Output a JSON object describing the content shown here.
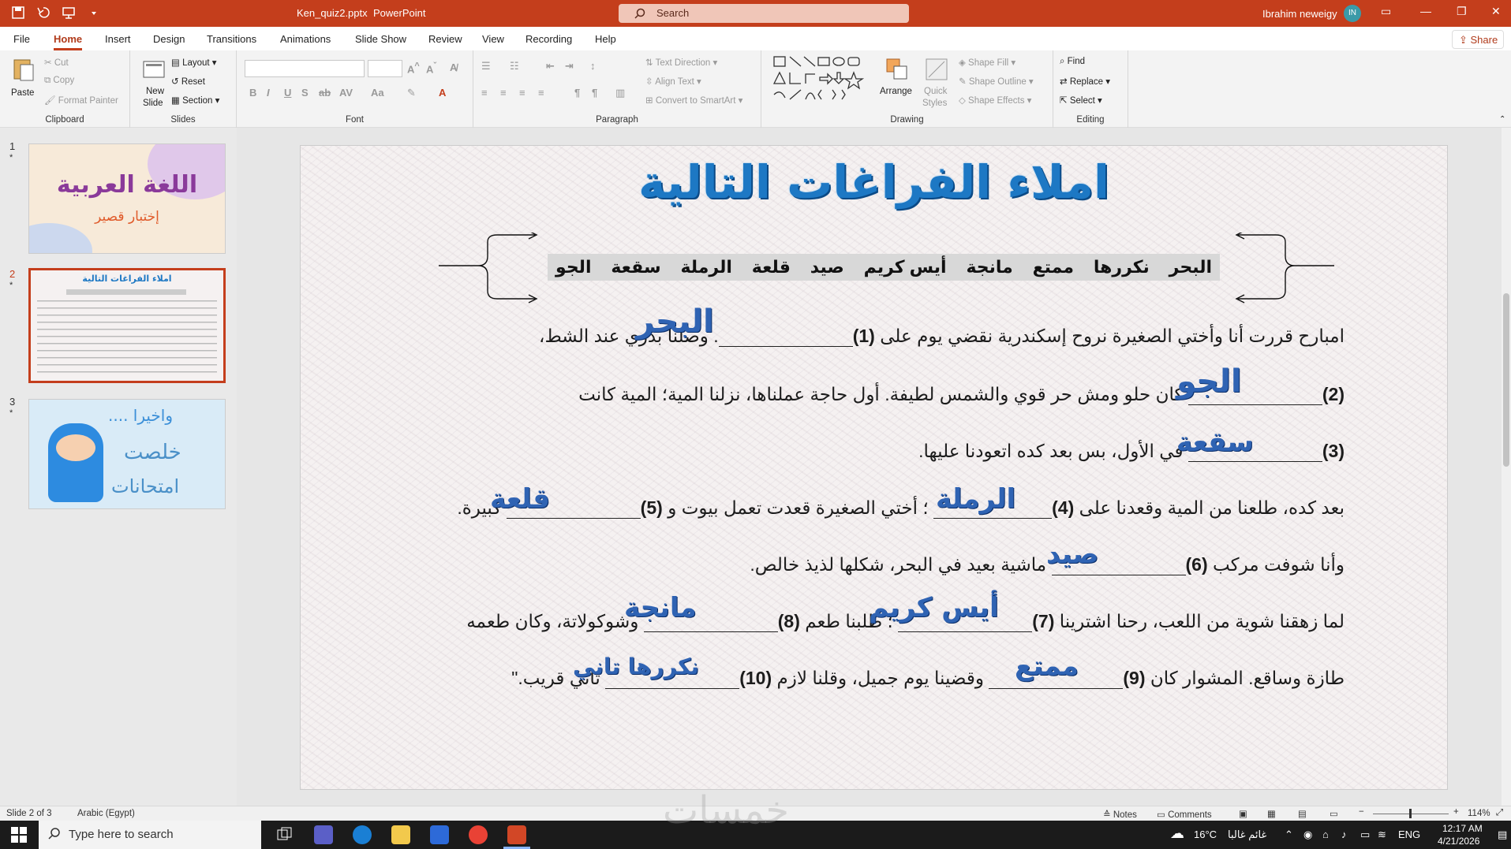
{
  "window": {
    "file_name": "Ken_quiz2.pptx",
    "app_name": "PowerPoint",
    "search_placeholder": "Search",
    "user_name": "Ibrahim neweigy",
    "user_initials": "IN"
  },
  "tabs": [
    "File",
    "Home",
    "Insert",
    "Design",
    "Transitions",
    "Animations",
    "Slide Show",
    "Review",
    "View",
    "Recording",
    "Help"
  ],
  "share_label": "Share",
  "ribbon": {
    "clipboard": {
      "label": "Clipboard",
      "paste": "Paste",
      "cut": "Cut",
      "copy": "Copy",
      "format_painter": "Format Painter"
    },
    "slides": {
      "label": "Slides",
      "new_slide_1": "New",
      "new_slide_2": "Slide",
      "layout": "Layout",
      "reset": "Reset",
      "section": "Section"
    },
    "font": {
      "label": "Font"
    },
    "paragraph": {
      "label": "Paragraph",
      "text_direction": "Text Direction",
      "align_text": "Align Text",
      "convert": "Convert to SmartArt"
    },
    "drawing": {
      "label": "Drawing",
      "arrange": "Arrange",
      "quick_styles_1": "Quick",
      "quick_styles_2": "Styles",
      "shape_fill": "Shape Fill",
      "shape_outline": "Shape Outline",
      "shape_effects": "Shape Effects"
    },
    "editing": {
      "label": "Editing",
      "find": "Find",
      "replace": "Replace",
      "select": "Select"
    }
  },
  "thumbnails": [
    {
      "num": "1",
      "title": "اللغة العربية",
      "subtitle": "إختبار قصير"
    },
    {
      "num": "2",
      "title": "املاء الفراغات التالية"
    },
    {
      "num": "3",
      "line1": "واخيرا ....",
      "line2": "خلصت",
      "line3": "امتحانات"
    }
  ],
  "slide": {
    "title": "املاء الفراغات التالية",
    "word_bank": [
      "البحر",
      "نكررها",
      "ممتع",
      "مانجة",
      "أيس كريم",
      "صيد",
      "قلعة",
      "الرملة",
      "سقعة",
      "الجو"
    ],
    "lines": [
      {
        "pre": "امبارح قررت أنا وأختي الصغيرة نروح إسكندرية نقضي يوم على",
        "num1": "(1)",
        "mid": ". وصلنا بدري عند الشط،"
      },
      {
        "num1": "(2)",
        "mid": "كان حلو ومش حر قوي والشمس لطيفة. أول حاجة عملناها، نزلنا المية؛ المية كانت"
      },
      {
        "num1": "(3)",
        "mid": "في الأول، بس بعد كده اتعودنا عليها."
      },
      {
        "pre": "بعد كده، طلعنا من المية وقعدنا على",
        "num1": "(4)",
        "mid": "؛ أختي الصغيرة قعدت تعمل بيوت و",
        "num2": "(5)",
        "post": "كبيرة."
      },
      {
        "pre": "وأنا شوفت مركب",
        "num1": "(6)",
        "mid": "ماشية بعيد في البحر، شكلها لذيذ خالص."
      },
      {
        "pre": "لما زهقنا شوية من اللعب، رحنا اشترينا",
        "num1": "(7)",
        "mid": "؛ طلبنا طعم",
        "num2": "(8)",
        "post": "وشوكولاتة، وكان طعمه"
      },
      {
        "pre": "طازة وساقع. المشوار كان",
        "num1": "(9)",
        "mid": "وقضينا يوم جميل، وقلنا لازم",
        "num2": "(10)",
        "post": "تاني قريب.\""
      }
    ],
    "answers": [
      "البحر",
      "الجو",
      "سقعة",
      "الرملة",
      "قلعة",
      "صيد",
      "أيس كريم",
      "مانجة",
      "ممتع",
      "نكررها تاني"
    ]
  },
  "status": {
    "slide_of": "Slide 2 of 3",
    "language": "Arabic (Egypt)",
    "notes": "Notes",
    "comments": "Comments",
    "zoom": "114%"
  },
  "taskbar": {
    "search_placeholder": "Type here to search",
    "temperature": "16°C",
    "weather_text": "غائم غالبا",
    "lang": "ENG",
    "time": "12:17 AM",
    "date": "4/21/2026"
  },
  "watermark": "خمسات",
  "colors": {
    "accent": "#c43e1c",
    "title_blue": "#1d78c4",
    "answer_blue": "#2f63b3"
  }
}
